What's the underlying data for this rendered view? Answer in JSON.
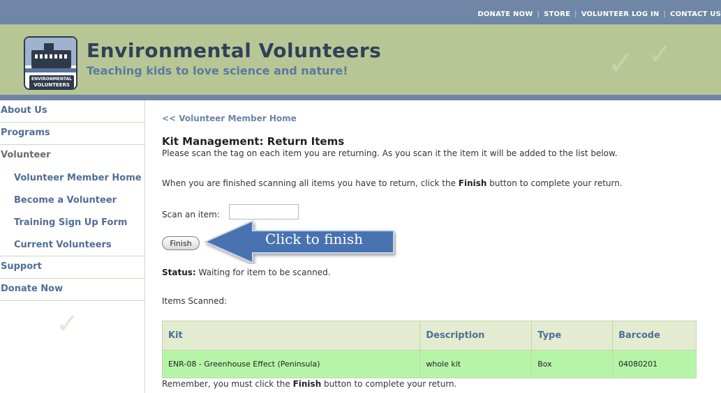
{
  "topnav": {
    "items": [
      "DONATE NOW",
      "STORE",
      "VOLUNTEER LOG IN",
      "CONTACT US"
    ],
    "separator": "|"
  },
  "header": {
    "title": "Environmental Volunteers",
    "tagline": "Teaching kids to love science and nature!",
    "logo_text": [
      "ENVIRONMENTAL",
      "VOLUNTEERS"
    ]
  },
  "sidebar": {
    "items": [
      {
        "label": "About Us"
      },
      {
        "label": "Programs"
      },
      {
        "label": "Volunteer"
      },
      {
        "label": "Volunteer Member Home"
      },
      {
        "label": "Become a Volunteer"
      },
      {
        "label": "Training Sign Up Form"
      },
      {
        "label": "Current Volunteers"
      },
      {
        "label": "Support"
      },
      {
        "label": "Donate Now"
      }
    ]
  },
  "main": {
    "back_link": "<< Volunteer Member Home",
    "title": "Kit Management: Return Items",
    "intro": "Please scan the tag on each item you are returning. As you scan it the item it will be added to the list below.",
    "instruction_pre": "When you are finished scanning all items you have to return, click the ",
    "instruction_bold": "Finish",
    "instruction_post": " button to complete your return.",
    "scan_label": "Scan an item:",
    "scan_value": "",
    "finish_label": "Finish",
    "callout": "Click to finish",
    "status_label": "Status:",
    "status_text": " Waiting for item to be scanned.",
    "items_label": "Items Scanned:",
    "table": {
      "headers": [
        "Kit",
        "Description",
        "Type",
        "Barcode"
      ],
      "rows": [
        [
          "ENR-08 - Greenhouse Effect (Peninsula)",
          "whole kit",
          "Box",
          "04080201"
        ]
      ]
    },
    "reminder_pre": "Remember, you must click the ",
    "reminder_bold": "Finish",
    "reminder_post": " button to complete your return."
  },
  "colors": {
    "topbar": "#6f86a6",
    "header": "#b7c694",
    "link": "#506e96",
    "row_highlight": "#b6f5a8",
    "callout_arrow": "#4a72b0"
  }
}
